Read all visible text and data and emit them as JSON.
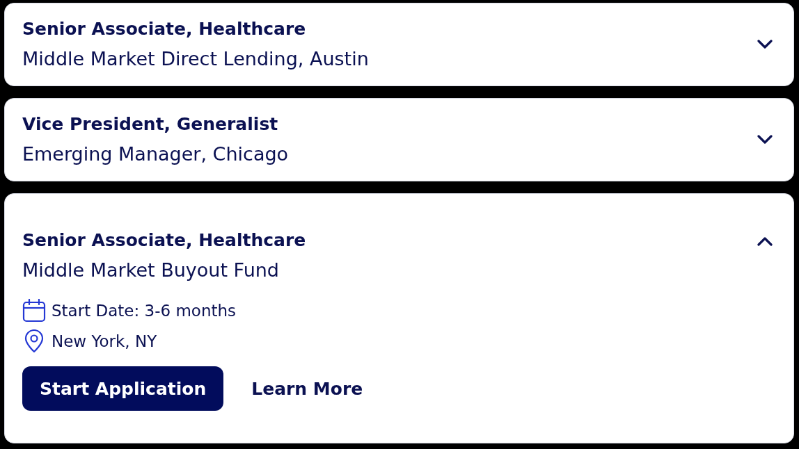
{
  "jobs": [
    {
      "title": "Senior Associate, Healthcare",
      "subtitle": "Middle Market Direct Lending, Austin",
      "expanded": false
    },
    {
      "title": "Vice President, Generalist",
      "subtitle": "Emerging Manager, Chicago",
      "expanded": false
    },
    {
      "title": "Senior Associate, Healthcare",
      "subtitle": "Middle Market Buyout Fund",
      "expanded": true,
      "details": [
        {
          "kind": "date",
          "text": "Start Date: 3-6 months"
        },
        {
          "kind": "location",
          "text": "New York, NY"
        }
      ],
      "actions": [
        {
          "kind": "primary",
          "label": "Start Application"
        },
        {
          "kind": "link",
          "label": "Learn More"
        }
      ]
    }
  ]
}
